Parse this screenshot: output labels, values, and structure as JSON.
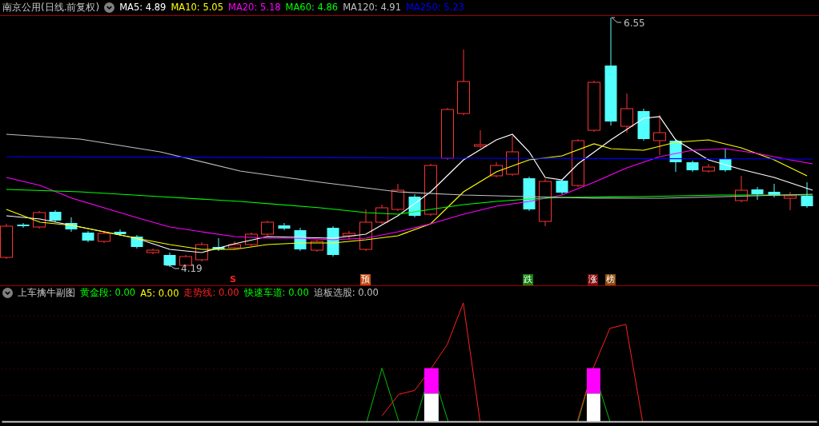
{
  "main_chart": {
    "title": "南京公用(日线.前复权)",
    "indicators": [
      {
        "text": "MA5: 4.89",
        "color": "#ffffff"
      },
      {
        "text": "MA10: 5.05",
        "color": "#ffff00"
      },
      {
        "text": "MA20: 5.18",
        "color": "#ff00ff"
      },
      {
        "text": "MA60: 4.86",
        "color": "#00ff00"
      },
      {
        "text": "MA120: 4.91",
        "color": "#c0c0c0"
      },
      {
        "text": "MA250: 5.23",
        "color": "#0000ff"
      }
    ],
    "high_label": "6.55",
    "low_label": "4.19",
    "signals": [
      {
        "text": "S",
        "kind": "plain",
        "color": "#ff2020"
      },
      {
        "text": "预",
        "kind": "tag",
        "color": "#c04a10"
      },
      {
        "text": "跌",
        "kind": "tag",
        "color": "#108010"
      },
      {
        "text": "涨",
        "kind": "tag",
        "color": "#801010"
      },
      {
        "text": "榜",
        "kind": "tag",
        "color": "#8a4a10"
      }
    ]
  },
  "sub_chart": {
    "title": "上车擒牛副图",
    "indicators": [
      {
        "text": "黄金段: 0.00",
        "color": "#00ff00"
      },
      {
        "text": "A5: 0.00",
        "color": "#ffff00"
      },
      {
        "text": "走势线: 0.00",
        "color": "#ff2020"
      },
      {
        "text": "快速车道: 0.00",
        "color": "#00ff00"
      },
      {
        "text": "追板选股: 0.00",
        "color": "#c0c0c0"
      }
    ]
  }
}
